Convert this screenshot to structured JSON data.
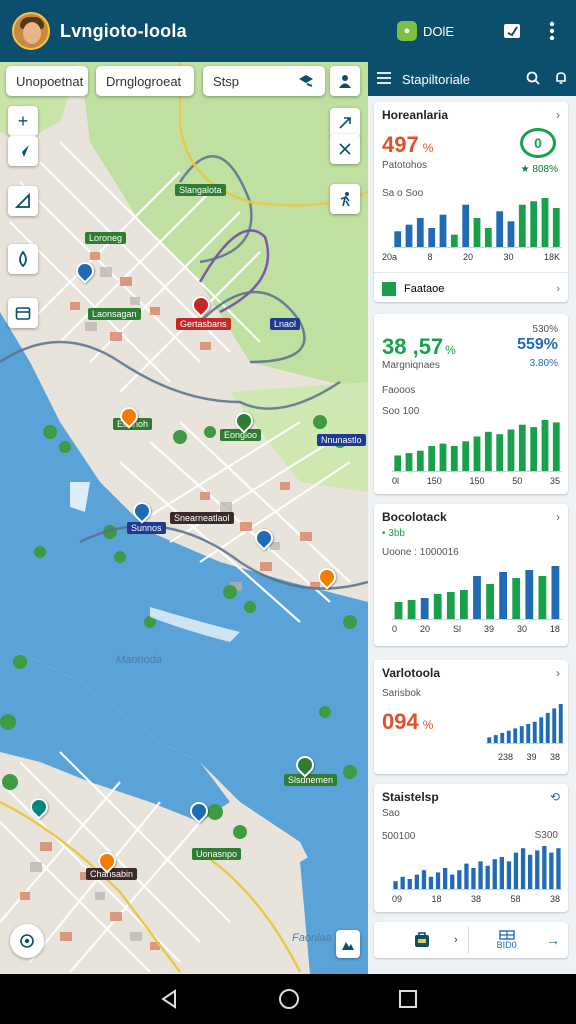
{
  "app": {
    "title": "Lvngioto-loola",
    "chip_label": "DOlE"
  },
  "map": {
    "search_chips": [
      "Unopoetnat",
      "Drnglogroeat",
      "Stsp"
    ],
    "water_label_1": "Mannoda",
    "water_label_2": "Faonlaa",
    "labels": [
      "Slangalota",
      "Loroneg",
      "Laonsagan",
      "Gertasbans",
      "Lnaol",
      "Eunnoh",
      "Eongloo",
      "Snearneatlaol",
      "Sunnos",
      "Nnunastlo",
      "Slsdnemen",
      "Uonasnpo",
      "Chansabin"
    ]
  },
  "panel": {
    "title": "Stapiltoriale",
    "card1": {
      "title": "Horeanlaria",
      "value": "497",
      "unit": "%",
      "badge": "0",
      "sub": "Patotohos",
      "rating": "★ 808%",
      "axis_label": "Sa o Soo",
      "ticks": [
        "20a",
        "8",
        "20",
        "30",
        "18K"
      ],
      "button": "Faataoe"
    },
    "card2": {
      "value": "38 ,57",
      "unit": "%",
      "right_value": "559%",
      "right_top": "530%",
      "right_sub": "3.80%",
      "sub": "Margniqnaes",
      "label": "Faooos",
      "axis_label": "Soo 100",
      "ticks": [
        "0l",
        "150",
        "150",
        "50",
        "35"
      ]
    },
    "card3": {
      "title": "Bocolotack",
      "sub": "• 3bb",
      "axis_label": "Uoone : 1000016",
      "ticks": [
        "0",
        "20",
        "Sl",
        "39",
        "30",
        "18"
      ]
    },
    "card4": {
      "title": "Varlotoola",
      "sub": "Sarisbok",
      "value": "094",
      "unit": "%",
      "ticks": [
        "238",
        "39",
        "38"
      ]
    },
    "card5": {
      "title": "Staistelsp",
      "sub": "Sao",
      "left_val": "500100",
      "right_val": "S300",
      "ticks": [
        "09",
        "18",
        "38",
        "58",
        "38"
      ]
    },
    "footer": {
      "right_label": "BID0"
    }
  },
  "chart_data": [
    {
      "type": "bar",
      "title": "Horeanlaria",
      "values": [
        10,
        14,
        18,
        12,
        20,
        8,
        26,
        18,
        12,
        22,
        16,
        26,
        28,
        30,
        24
      ],
      "colors": [
        "#1f6bb5",
        "#1f6bb5",
        "#1f6bb5",
        "#1f6bb5",
        "#1f6bb5",
        "#18a04b",
        "#1f6bb5",
        "#18a04b",
        "#18a04b",
        "#1f6bb5",
        "#1f6bb5",
        "#18a04b",
        "#18a04b",
        "#18a04b",
        "#18a04b"
      ]
    },
    {
      "type": "bar",
      "title": "Soo 100",
      "values": [
        14,
        16,
        18,
        22,
        24,
        22,
        26,
        30,
        34,
        32,
        36,
        40,
        38,
        44,
        42
      ],
      "colors": [
        "#18a04b"
      ]
    },
    {
      "type": "bar",
      "title": "Bocolotack",
      "values": [
        18,
        20,
        22,
        26,
        28,
        30,
        44,
        36,
        48,
        42,
        50,
        44,
        54
      ],
      "colors": [
        "#18a04b",
        "#18a04b",
        "#1f6bb5",
        "#18a04b",
        "#18a04b",
        "#18a04b",
        "#1f6bb5",
        "#18a04b",
        "#1f6bb5",
        "#18a04b",
        "#1f6bb5",
        "#18a04b",
        "#1f6bb5"
      ]
    },
    {
      "type": "bar",
      "title": "Varlotoola",
      "values": [
        6,
        8,
        10,
        12,
        14,
        16,
        18,
        20,
        24,
        28,
        32,
        36
      ],
      "colors": [
        "#1f6bb5"
      ]
    },
    {
      "type": "bar",
      "title": "Staistelsp",
      "values": [
        8,
        12,
        10,
        14,
        18,
        12,
        16,
        20,
        14,
        18,
        24,
        20,
        26,
        22,
        28,
        30,
        26,
        34,
        38,
        32,
        36,
        40,
        34,
        38
      ],
      "colors": [
        "#1f6bb5"
      ]
    }
  ]
}
